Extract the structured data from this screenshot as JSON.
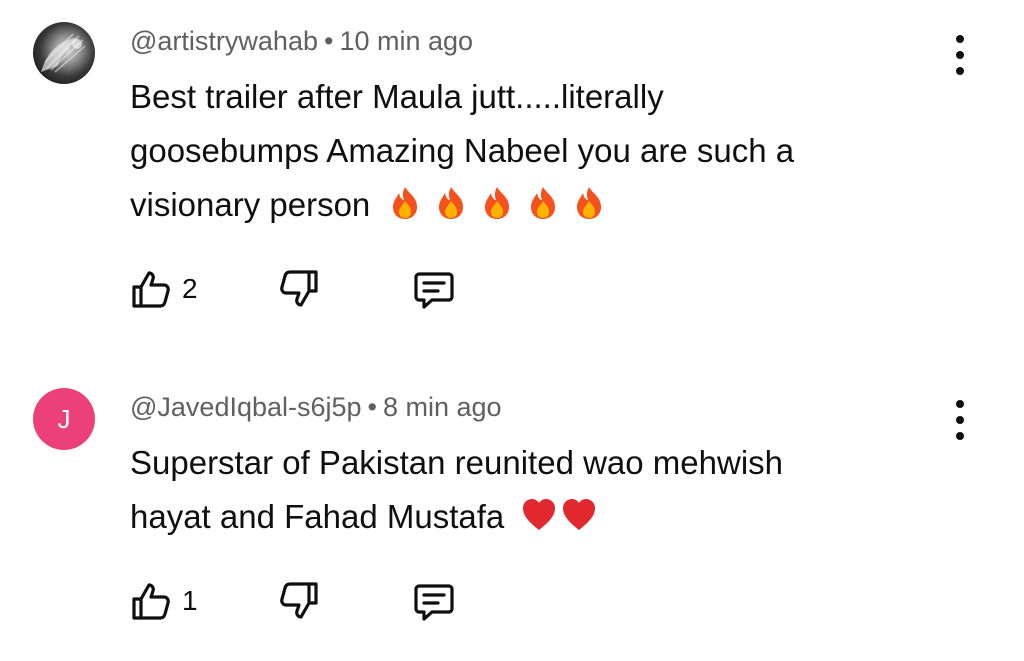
{
  "comments": [
    {
      "author": "@artistrywahab",
      "separator": "•",
      "time": "10 min ago",
      "lines": [
        "Best trailer after Maula jutt.....literally",
        "goosebumps Amazing Nabeel you are such a",
        "visionary person"
      ],
      "emoji": "fire",
      "emoji_count": 5,
      "likes": "2"
    },
    {
      "author": "@JavedIqbal-s6j5p",
      "separator": "•",
      "time": "8 min ago",
      "avatar_letter": "J",
      "avatar_color": "#ec407a",
      "lines": [
        "Superstar of Pakistan reunited wao mehwish",
        "hayat and Fahad Mustafa"
      ],
      "emoji": "red-heart",
      "emoji_count": 2,
      "likes": "1"
    }
  ],
  "icons": {
    "like": "thumb-up-icon",
    "dislike": "thumb-down-icon",
    "reply": "reply-comment-icon",
    "menu": "more-vertical-icon"
  }
}
